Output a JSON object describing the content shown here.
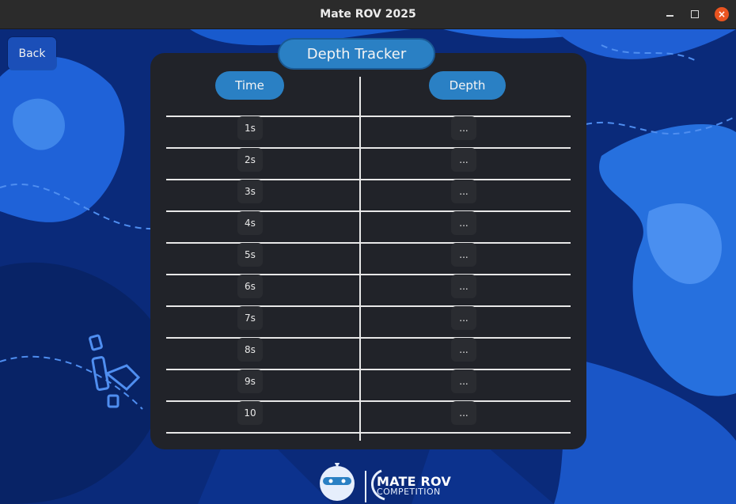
{
  "window": {
    "title": "Mate ROV 2025",
    "minimize": "minimize",
    "maximize": "maximize",
    "close": "×"
  },
  "nav": {
    "back_label": "Back"
  },
  "tracker": {
    "title": "Depth Tracker",
    "columns": {
      "time": "Time",
      "depth": "Depth"
    },
    "rows": [
      {
        "time": "1s",
        "depth": "..."
      },
      {
        "time": "2s",
        "depth": "..."
      },
      {
        "time": "3s",
        "depth": "..."
      },
      {
        "time": "4s",
        "depth": "..."
      },
      {
        "time": "5s",
        "depth": "..."
      },
      {
        "time": "6s",
        "depth": "..."
      },
      {
        "time": "7s",
        "depth": "..."
      },
      {
        "time": "8s",
        "depth": "..."
      },
      {
        "time": "9s",
        "depth": "..."
      },
      {
        "time": "10",
        "depth": "..."
      }
    ]
  },
  "footer": {
    "brand_line1": "MATE ROV",
    "brand_line2": "COMPETITION"
  },
  "colors": {
    "accent": "#2a80c4",
    "panel": "#212329",
    "background": "#0a2a7a",
    "close": "#e95420"
  }
}
